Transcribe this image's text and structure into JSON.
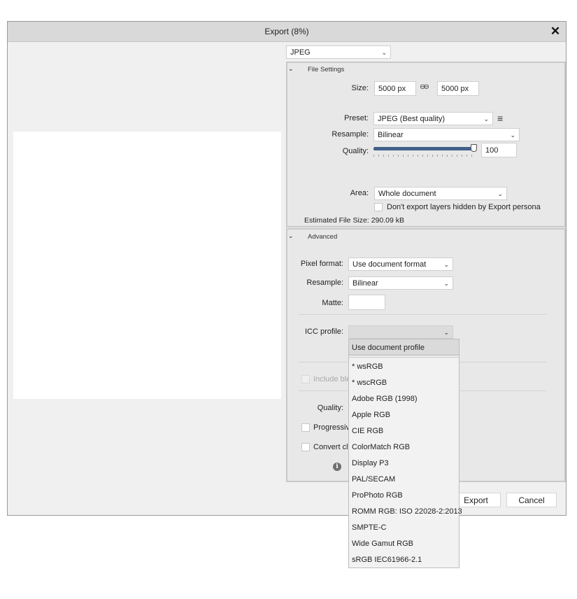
{
  "dialog": {
    "title": "Export (8%)",
    "close_glyph": "✕"
  },
  "format": {
    "value": "JPEG"
  },
  "file_settings": {
    "header": "File Settings",
    "size_label": "Size:",
    "width": "5000 px",
    "height": "5000 px",
    "link_glyph": "⊖⊖",
    "preset_label": "Preset:",
    "preset": "JPEG (Best quality)",
    "resample_label": "Resample:",
    "resample": "Bilinear",
    "quality_label": "Quality:",
    "quality": "100",
    "quality_fraction": 1.0,
    "area_label": "Area:",
    "area": "Whole document",
    "hidden_layers_label": "Don't export layers hidden by Export persona",
    "estimated_size": "Estimated File Size: 290.09 kB"
  },
  "advanced": {
    "header": "Advanced",
    "pixel_format_label": "Pixel format:",
    "pixel_format": "Use document format",
    "resample_label": "Resample:",
    "resample": "Bilinear",
    "matte_label": "Matte:",
    "icc_label": "ICC profile:",
    "include_bleed_partial": "Include ble",
    "quality_label": "Quality:",
    "progressive_partial": "Progressiv",
    "convert_partial": "Convert cl"
  },
  "icc_options": {
    "selected": "Use document profile",
    "items": [
      "* wsRGB",
      "* wscRGB",
      "Adobe RGB (1998)",
      "Apple RGB",
      "CIE RGB",
      "ColorMatch RGB",
      "Display P3",
      "PAL/SECAM",
      "ProPhoto RGB",
      "ROMM RGB: ISO 22028-2:2013",
      "SMPTE-C",
      "Wide Gamut RGB",
      "sRGB IEC61966-2.1"
    ]
  },
  "buttons": {
    "export": "Export",
    "cancel": "Cancel"
  },
  "icons": {
    "chevron": "chevron-down-icon",
    "collapse": "chevron-down-icon",
    "menu": "hamburger-icon",
    "info": "info-icon",
    "link": "link-icon",
    "close": "close-icon"
  },
  "colors": {
    "slider_fill": "#42618a",
    "titlebar": "#d9d9d9",
    "panel": "#e8e8e8"
  }
}
